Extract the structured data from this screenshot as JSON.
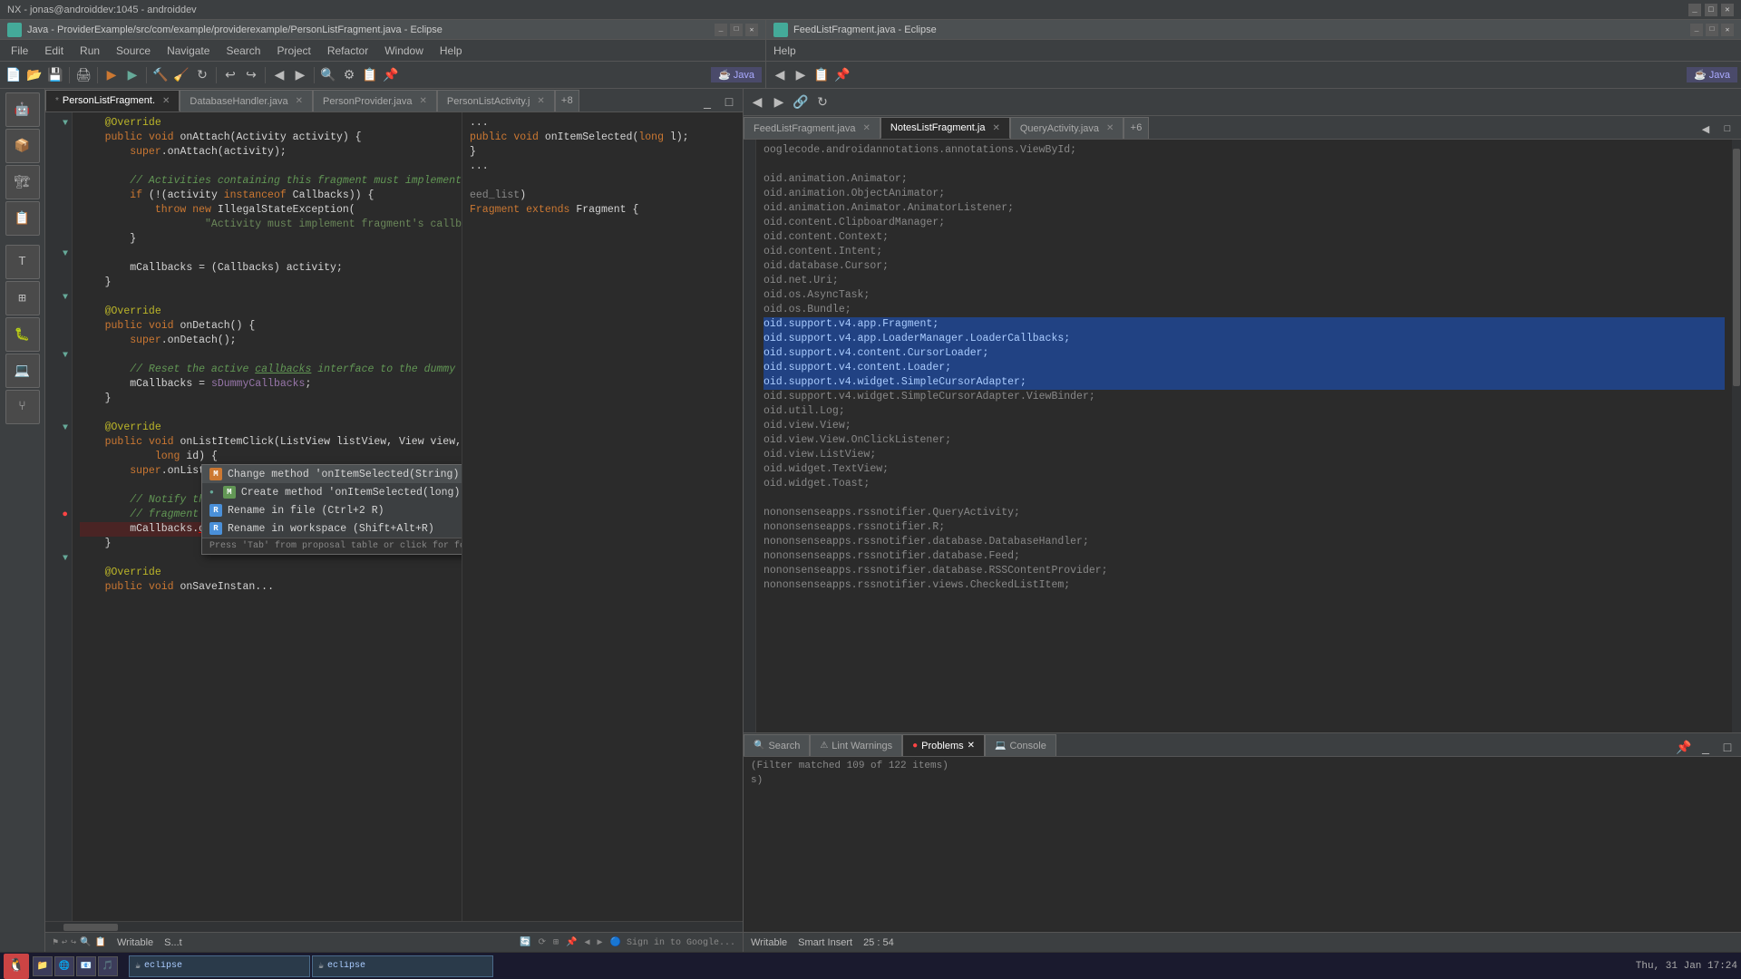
{
  "titleBar": {
    "title": "NX - jonas@androiddev:1045 - androiddev",
    "leftWindowTitle": "Java - ProviderExample/src/com/example/providerexample/PersonListFragment.java - Eclipse",
    "rightWindowTitle": "FeedListFragment.java - Eclipse"
  },
  "menuBar": {
    "items": [
      "File",
      "Edit",
      "Run",
      "Source",
      "Navigate",
      "Search",
      "Project",
      "Refactor",
      "Window",
      "Help"
    ]
  },
  "rightMenuBar": {
    "items": [
      "Help"
    ]
  },
  "leftTabs": [
    {
      "label": "*PersonListFragment.",
      "active": true
    },
    {
      "label": "DatabaseHandler.java",
      "active": false
    },
    {
      "label": "PersonProvider.java",
      "active": false
    },
    {
      "label": "PersonListActivity.j",
      "active": false
    },
    {
      "label": "+8",
      "active": false
    }
  ],
  "rightTabs": [
    {
      "label": "FeedListFragment.java",
      "active": true
    },
    {
      "label": "NotesListFragment.ja",
      "active": false
    },
    {
      "label": "QueryActivity.java",
      "active": false
    },
    {
      "label": "+6",
      "active": false
    }
  ],
  "leftCode": {
    "lines": [
      {
        "num": "",
        "content": "    @Override"
      },
      {
        "num": "",
        "content": "    public void onAttach(Activity activity) {"
      },
      {
        "num": "",
        "content": "        super.onAttach(activity);"
      },
      {
        "num": "",
        "content": ""
      },
      {
        "num": "",
        "content": "        // Activities containing this fragment must implement its callbacks."
      },
      {
        "num": "",
        "content": "        if (!(activity instanceof Callbacks)) {"
      },
      {
        "num": "",
        "content": "            throw new IllegalStateException("
      },
      {
        "num": "",
        "content": "                    \"Activity must implement fragment's callbacks.\");"
      },
      {
        "num": "",
        "content": "        }"
      },
      {
        "num": "",
        "content": ""
      },
      {
        "num": "",
        "content": "        mCallbacks = (Callbacks) activity;"
      },
      {
        "num": "",
        "content": "    }"
      },
      {
        "num": "",
        "content": ""
      },
      {
        "num": "",
        "content": "    @Override"
      },
      {
        "num": "",
        "content": "    public void onDetach() {"
      },
      {
        "num": "",
        "content": "        super.onDetach();"
      },
      {
        "num": "",
        "content": ""
      },
      {
        "num": "",
        "content": "        // Reset the active callbacks interface to the dummy implementation."
      },
      {
        "num": "",
        "content": "        mCallbacks = sDummyCallbacks;"
      },
      {
        "num": "",
        "content": "    }"
      },
      {
        "num": "",
        "content": ""
      },
      {
        "num": "",
        "content": "    @Override"
      },
      {
        "num": "",
        "content": "    public void onListItemClick(ListView listView, View view, int position,"
      },
      {
        "num": "",
        "content": "            long id) {"
      },
      {
        "num": "",
        "content": "        super.onListItemClick(listView, view, position, id);"
      },
      {
        "num": "",
        "content": ""
      },
      {
        "num": "",
        "content": "        // Notify the active callbacks interface (the activity, if the"
      },
      {
        "num": "",
        "content": "        // fragment is attached to one) that an item has been selected."
      },
      {
        "num": "",
        "content": "        mCallbacks.onItemSelected(getListAdapter().getItemId(position));"
      },
      {
        "num": "",
        "content": "    }"
      },
      {
        "num": "",
        "content": ""
      },
      {
        "num": "",
        "content": "    @Override"
      },
      {
        "num": "",
        "content": "    public void onSaveInstan..."
      }
    ]
  },
  "autocomplete": {
    "items": [
      {
        "icon": "M",
        "iconClass": "ac-orange",
        "text": "Change method 'onItemSelected(String)' to 'onItem...'"
      },
      {
        "icon": "M",
        "iconClass": "ac-green",
        "text": "Create method 'onItemSelected(long)' in type 'Callb...'"
      },
      {
        "icon": "R",
        "iconClass": "ac-blue",
        "text": "Rename in file (Ctrl+2 R)"
      },
      {
        "icon": "R",
        "iconClass": "ac-blue",
        "text": "Rename in workspace (Shift+Alt+R)"
      }
    ],
    "hint": "Press 'Tab' from proposal table or click for focus"
  },
  "rightCode": {
    "imports": [
      "ooglecode.androidannotations.annotations.ViewById;",
      "",
      "oid.animation.Animator;",
      "oid.animation.ObjectAnimator;",
      "oid.animation.Animator.AnimatorListener;",
      "oid.content.ClipboardManager;",
      "oid.content.Context;",
      "oid.content.Intent;",
      "oid.database.Cursor;",
      "oid.net.Uri;",
      "oid.os.AsyncTask;",
      "oid.os.Bundle;",
      "oid.support.v4.app.Fragment;",
      "oid.support.v4.app.LoaderManager.LoaderCallbacks;",
      "oid.support.v4.content.CursorLoader;",
      "oid.support.v4.content.Loader;",
      "oid.support.v4.widget.SimpleCursorAdapter;",
      "oid.support.v4.widget.SimpleCursorAdapter.ViewBinder;",
      "oid.util.Log;",
      "oid.view.View;",
      "oid.view.View.OnClickListener;",
      "oid.view.ListView;",
      "oid.widget.TextView;",
      "oid.widget.Toast;",
      "",
      "nononsenseapps.rssnotifier.QueryActivity;",
      "nononsenseapps.rssnotifier.R;",
      "nononsenseapps.rssnotifier.database.DatabaseHandler;",
      "nononsenseapps.rssnotifier.database.Feed;",
      "nononsenseapps.rssnotifier.database.RSSContentProvider;",
      "nononsenseapps.rssnotifier.views.CheckedListItem;"
    ],
    "afterImports": [
      "*/",
      "public void onItemSelected(long l);",
      "}",
      "...",
      "",
      "eed_list)",
      "Fragment extends Fragment {"
    ]
  },
  "bottomPanel": {
    "tabs": [
      {
        "label": "Search",
        "active": false
      },
      {
        "label": "Lint Warnings",
        "active": false
      },
      {
        "label": "Problems",
        "active": true
      },
      {
        "label": "Console",
        "active": false
      }
    ],
    "filterText": "(Filter matched 109 of 122 items)",
    "contentLine": "s)"
  },
  "statusBarLeft": {
    "writable": "Writable",
    "smart": "S...t"
  },
  "statusBarRight": {
    "writable": "Writable",
    "insertMode": "Smart Insert",
    "position": "25 : 54",
    "date": "Thu, 31 Jan  17:24"
  },
  "systemTray": {
    "date": "Thu, 31 Jan  17:24"
  }
}
